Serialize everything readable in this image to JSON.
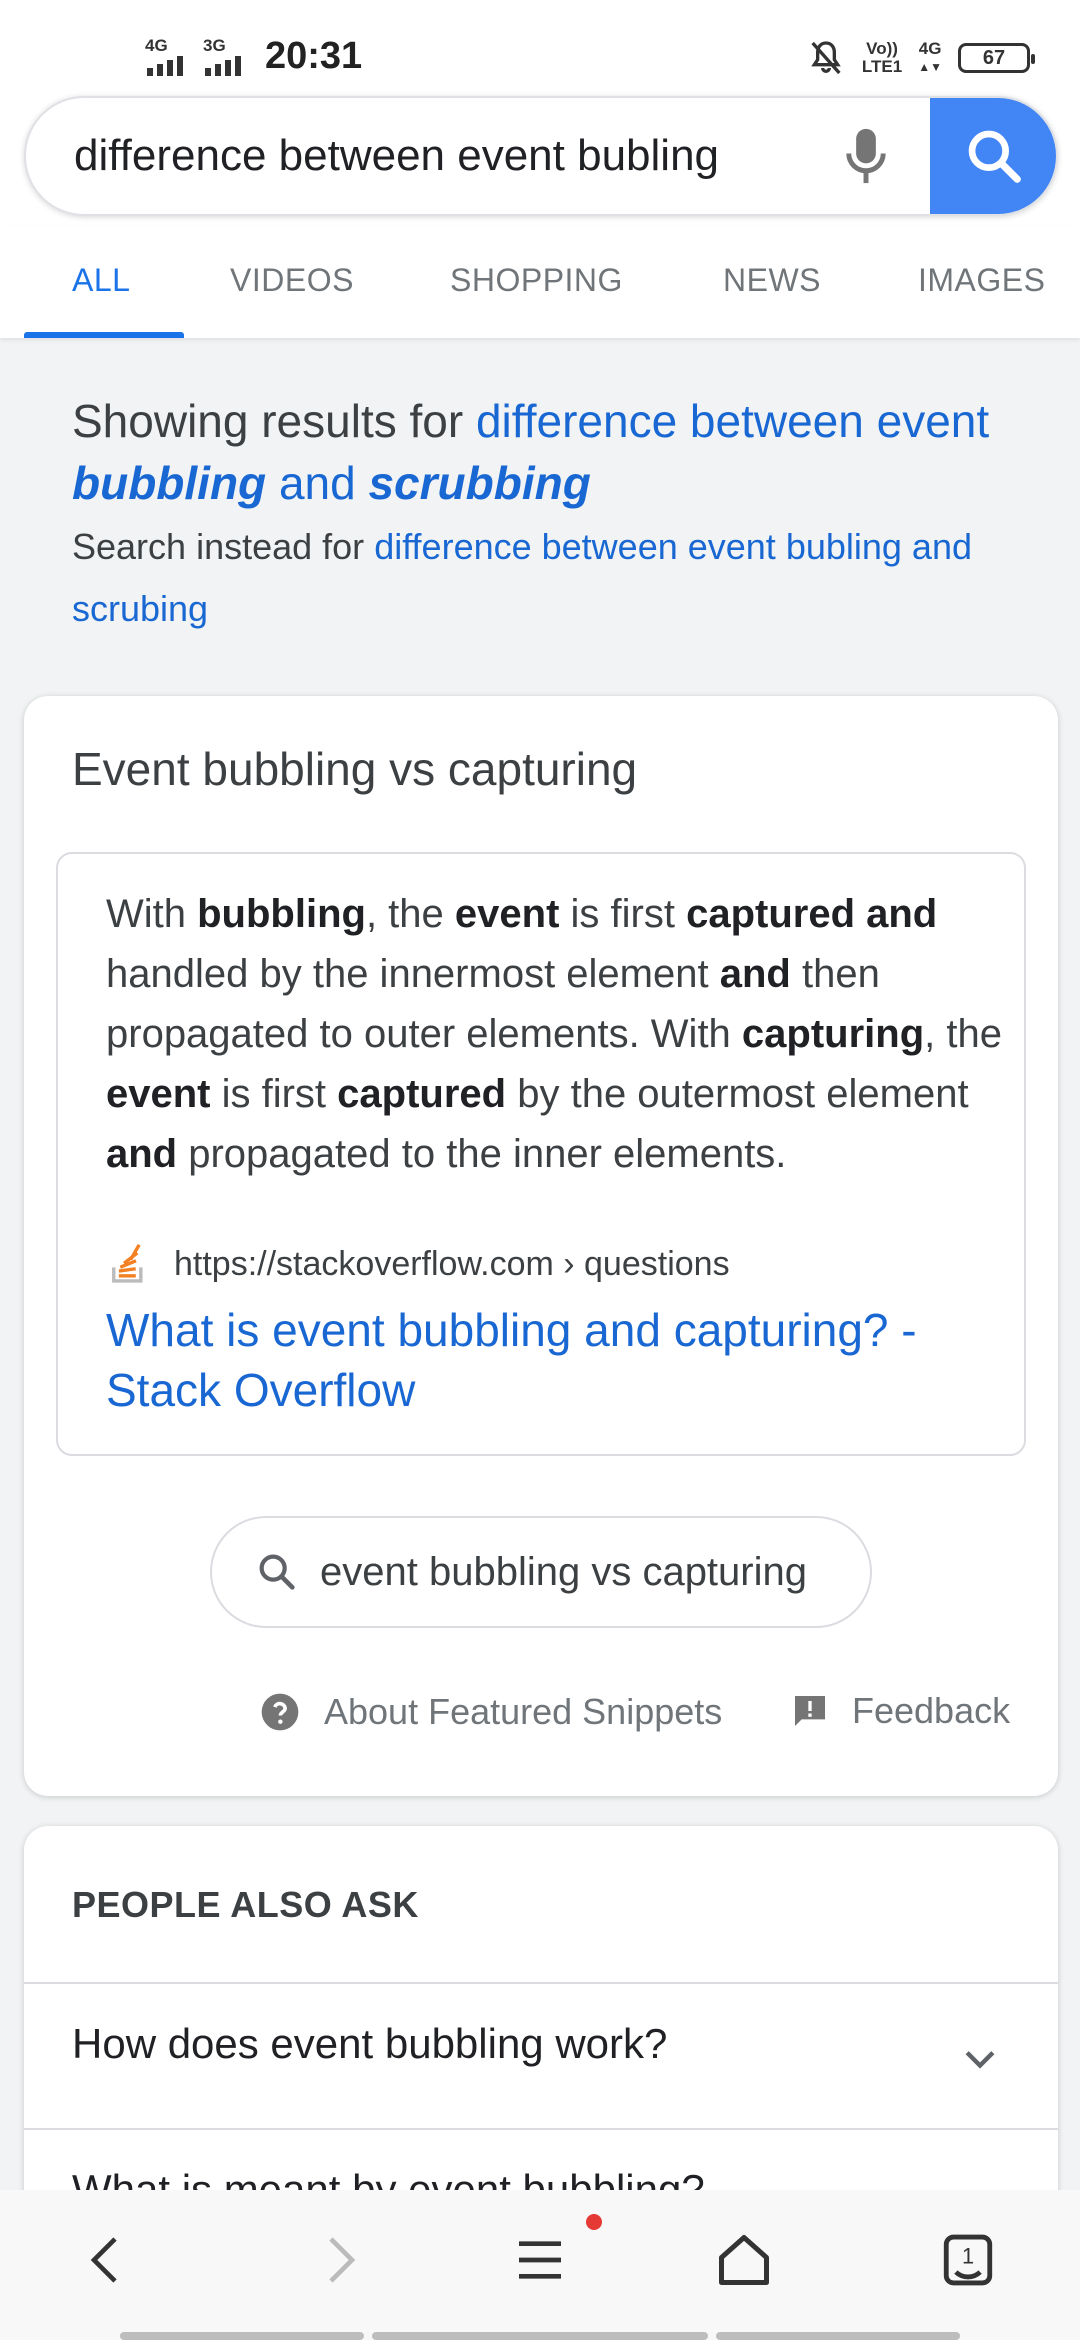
{
  "status_bar": {
    "net1": "4G",
    "net2": "3G",
    "time": "20:31",
    "volte_top": "Vo))",
    "volte_bottom": "LTE1",
    "net3": "4G",
    "battery": "67",
    "icons": [
      "signal-icon",
      "signal-icon",
      "mute-bell-icon",
      "battery-icon"
    ]
  },
  "search": {
    "query": "difference between event bubling",
    "mic_icon": "mic-icon",
    "search_icon": "search-icon",
    "button_color": "#4285f4"
  },
  "tabs": [
    "ALL",
    "VIDEOS",
    "SHOPPING",
    "NEWS",
    "IMAGES"
  ],
  "spelling": {
    "showing_prefix": "Showing results for",
    "corrected_part1": "difference between event",
    "corrected_bold1": "bubbling",
    "corrected_and": "and",
    "corrected_bold2": "scrubbing",
    "instead_prefix": "Search instead for",
    "original_query": "difference between event bubling and scrubing"
  },
  "featured": {
    "title": "Event bubbling vs capturing",
    "snippet": {
      "t1": "With ",
      "b1": "bubbling",
      "t2": ", the ",
      "b2": "event",
      "t3": " is first ",
      "b3": "captured and",
      "t4": " handled by the innermost element ",
      "b4": "and",
      "t5": " then propagated to outer elements. With ",
      "b5": "capturing",
      "t6": ", the ",
      "b6": "event",
      "t7": " is first ",
      "b7": "captured",
      "t8": " by the outermost element ",
      "b8": "and",
      "t9": " propagated to the inner elements."
    },
    "source_url": "https://stackoverflow.com › questions",
    "source_icon": "stackoverflow-icon",
    "link_title": "What is event bubbling and capturing? - Stack Overflow",
    "related_search": "event bubbling vs capturing",
    "about_label": "About Featured Snippets",
    "feedback_label": "Feedback"
  },
  "people_also_ask": {
    "title": "PEOPLE ALSO ASK",
    "questions": [
      "How does event bubbling work?",
      "What is meant by event bubbling?"
    ]
  },
  "bottom_nav": {
    "tab_count": "1",
    "icons": [
      "back-icon",
      "forward-icon",
      "menu-icon",
      "home-icon",
      "tabs-icon"
    ]
  },
  "colors": {
    "accent": "#1a73e8",
    "link": "#1967d2",
    "notification_dot": "#e53935"
  }
}
